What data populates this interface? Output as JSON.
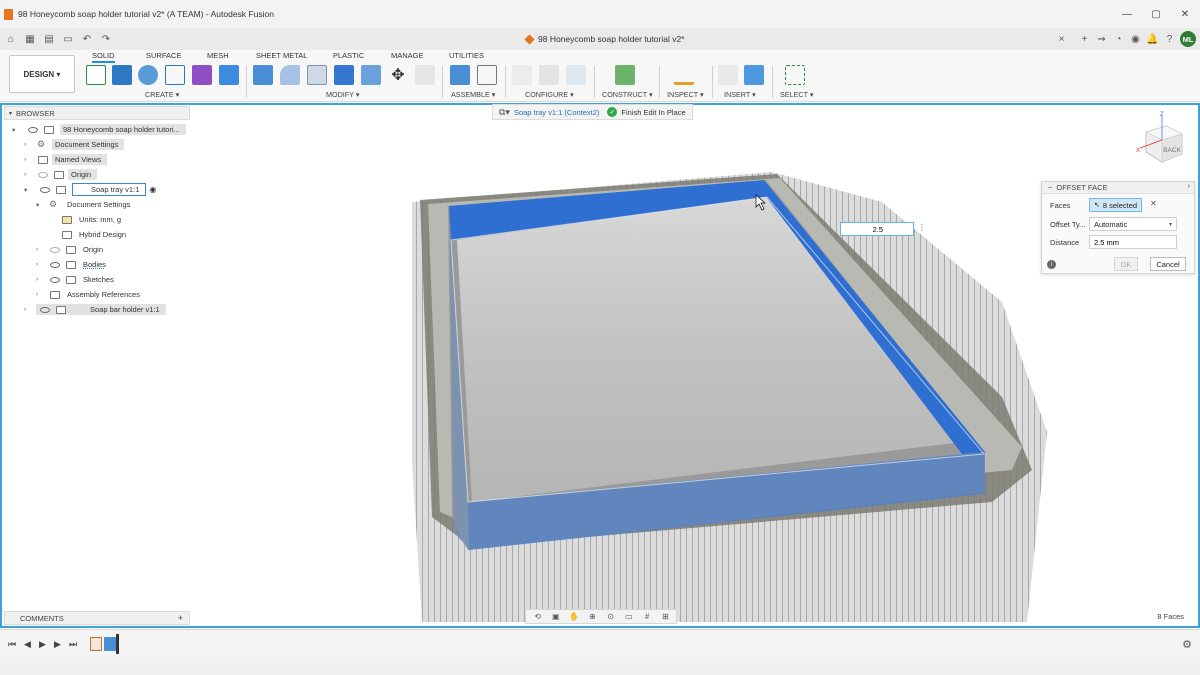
{
  "window": {
    "title": "98 Honeycomb soap holder tutorial v2* (A TEAM) - Autodesk Fusion",
    "minimize_icon": "minimize-icon",
    "maximize_icon": "maximize-icon",
    "close_icon": "close-icon"
  },
  "document_tab": {
    "title": "98 Honeycomb soap holder tutorial v2*",
    "close": "×"
  },
  "user": {
    "initials": "ML"
  },
  "workspace": {
    "label": "DESIGN ▾"
  },
  "tabs": [
    {
      "label": "SOLID",
      "active": true
    },
    {
      "label": "SURFACE"
    },
    {
      "label": "MESH"
    },
    {
      "label": "SHEET METAL"
    },
    {
      "label": "PLASTIC"
    },
    {
      "label": "MANAGE"
    },
    {
      "label": "UTILITIES"
    }
  ],
  "tool_groups": [
    {
      "label": "CREATE ▾"
    },
    {
      "label": "MODIFY ▾"
    },
    {
      "label": "ASSEMBLE ▾"
    },
    {
      "label": "CONFIGURE ▾"
    },
    {
      "label": "CONSTRUCT ▾"
    },
    {
      "label": "INSPECT ▾"
    },
    {
      "label": "INSERT ▾"
    },
    {
      "label": "SELECT ▾"
    }
  ],
  "browser": {
    "title": "BROWSER",
    "items": [
      {
        "label": "98 Honeycomb soap holder tutori..."
      },
      {
        "label": "Document Settings"
      },
      {
        "label": "Named Views"
      },
      {
        "label": "Origin"
      },
      {
        "label": "Soap tray v1:1"
      },
      {
        "label": "Document Settings"
      },
      {
        "label": "Units: mm, g"
      },
      {
        "label": "Hybrid Design"
      },
      {
        "label": "Origin"
      },
      {
        "label": "Bodies"
      },
      {
        "label": "Sketches"
      },
      {
        "label": "Assembly References"
      },
      {
        "label": "Soap bar holder v1:1"
      }
    ]
  },
  "comments": {
    "title": "COMMENTS",
    "add": "+"
  },
  "context_bar": {
    "component": "Soap tray v1:1 (Context2)",
    "finish": "Finish Edit In Place"
  },
  "canvas_input": {
    "value": "2.5"
  },
  "dialog": {
    "title": "OFFSET FACE",
    "faces_label": "Faces",
    "faces_value": "8 selected",
    "offset_type_label": "Offset Ty...",
    "offset_type_value": "Automatic",
    "distance_label": "Distance",
    "distance_value": "2.5 mm",
    "ok": "OK",
    "cancel": "Cancel"
  },
  "viewcube": {
    "face": "BACK",
    "axis_z": "Z",
    "axis_x": "X"
  },
  "status": {
    "selection_count": "8 Faces"
  },
  "colors": {
    "accent": "#3aa4d8",
    "selected_face": "#2f6fd1",
    "model_gray": "#8c8c8c"
  }
}
